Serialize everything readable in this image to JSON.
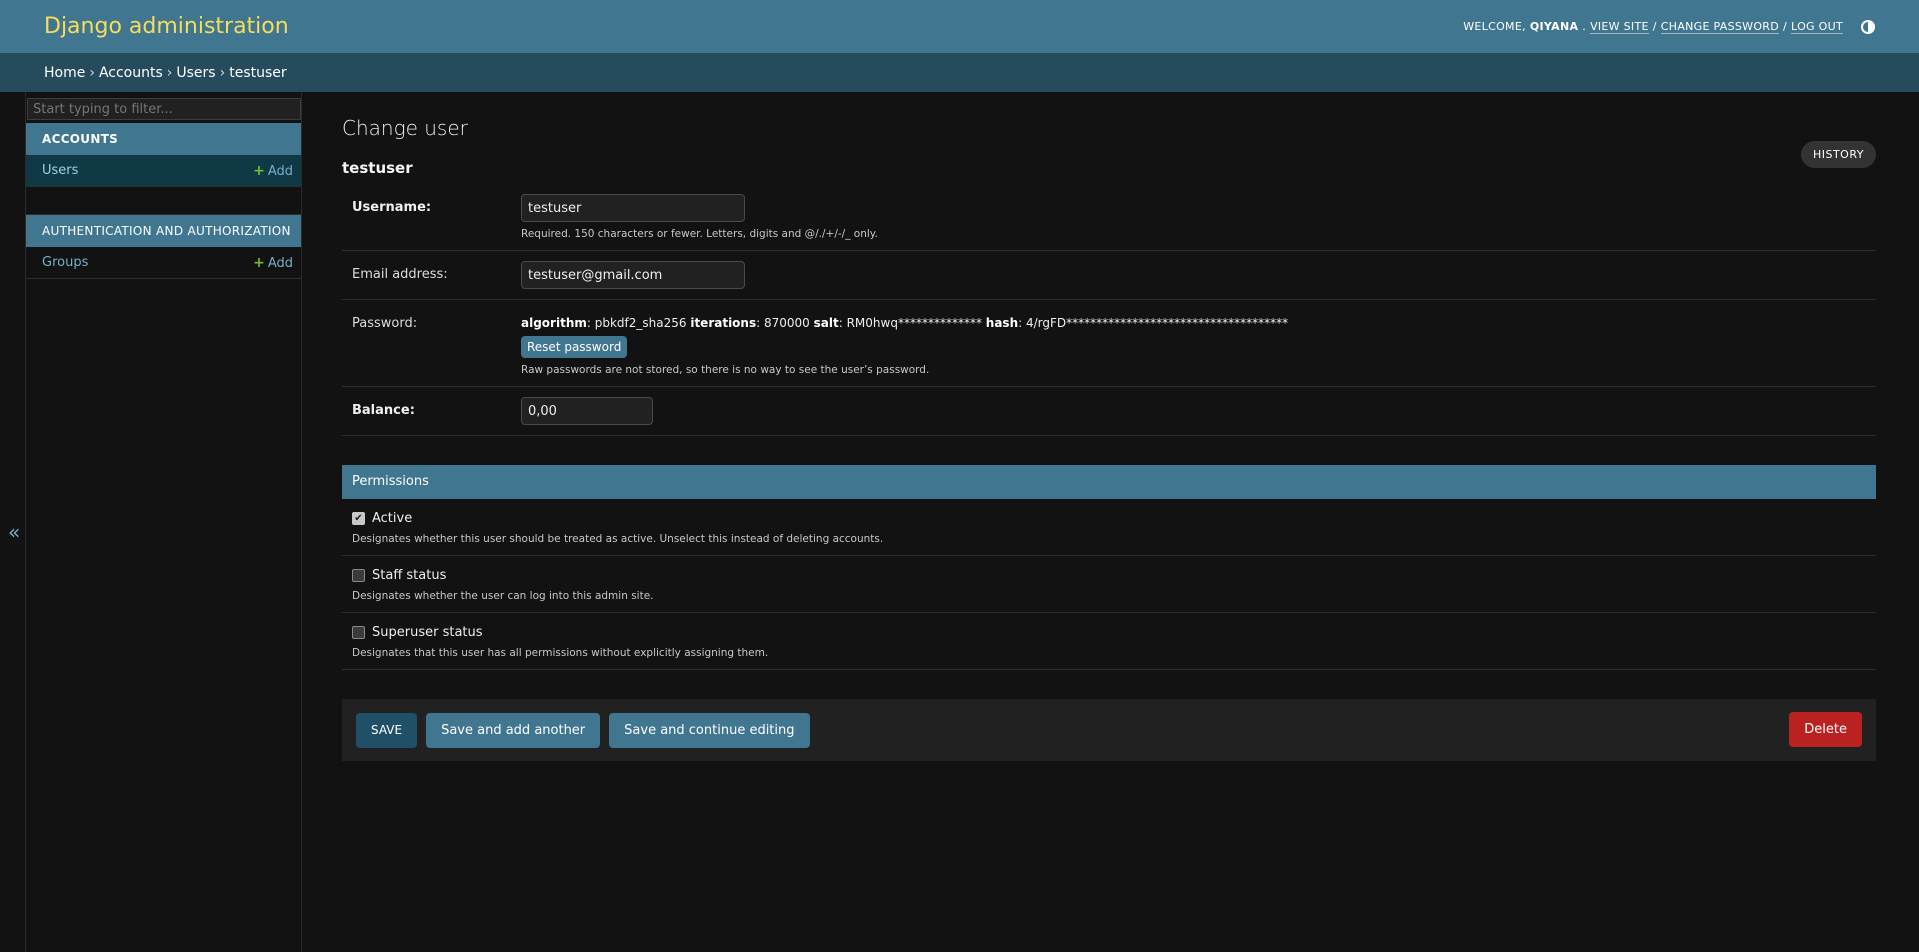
{
  "header": {
    "brand": "Django administration",
    "welcome": "WELCOME,",
    "username": "QIYANA",
    "welcome_suffix": ".",
    "view_site": "VIEW SITE",
    "change_password": "CHANGE PASSWORD",
    "log_out": "LOG OUT",
    "separator": "/"
  },
  "breadcrumbs": {
    "items": [
      "Home",
      "Accounts",
      "Users"
    ],
    "current": "testuser",
    "separator": "›"
  },
  "sidebar": {
    "filter_placeholder": "Start typing to filter...",
    "toggle_icon": "«",
    "modules": [
      {
        "caption": "ACCOUNTS",
        "models": [
          {
            "name": "Users",
            "add": "Add"
          }
        ]
      },
      {
        "caption": "AUTHENTICATION AND AUTHORIZATION",
        "models": [
          {
            "name": "Groups",
            "add": "Add"
          }
        ]
      }
    ]
  },
  "content": {
    "title": "Change user",
    "object_name": "testuser",
    "history": "HISTORY",
    "fields": {
      "username": {
        "label": "Username:",
        "value": "testuser",
        "help": "Required. 150 characters or fewer. Letters, digits and @/./+/-/_ only."
      },
      "email": {
        "label": "Email address:",
        "value": "testuser@gmail.com"
      },
      "password": {
        "label": "Password:",
        "algorithm_label": "algorithm",
        "algorithm": "pbkdf2_sha256",
        "iterations_label": "iterations",
        "iterations": "870000",
        "salt_label": "salt",
        "salt": "RM0hwq**************",
        "hash_label": "hash",
        "hash": "4/rgFD*************************************",
        "reset": "Reset password",
        "help": "Raw passwords are not stored, so there is no way to see the user’s password."
      },
      "balance": {
        "label": "Balance:",
        "value": "0,00"
      }
    },
    "permissions": {
      "caption": "Permissions",
      "items": [
        {
          "label": "Active",
          "checked": true,
          "help": "Designates whether this user should be treated as active. Unselect this instead of deleting accounts."
        },
        {
          "label": "Staff status",
          "checked": false,
          "help": "Designates whether the user can log into this admin site."
        },
        {
          "label": "Superuser status",
          "checked": false,
          "help": "Designates that this user has all permissions without explicitly assigning them."
        }
      ]
    },
    "submit": {
      "save": "SAVE",
      "save_add": "Save and add another",
      "save_continue": "Save and continue editing",
      "delete": "Delete"
    }
  },
  "colors": {
    "header_bg": "#417690",
    "breadcrumbs_bg": "#264b5d",
    "brand": "#f5dd5d",
    "link": "#79aec8",
    "add_plus": "#70bf2b",
    "delete": "#ba2121"
  }
}
